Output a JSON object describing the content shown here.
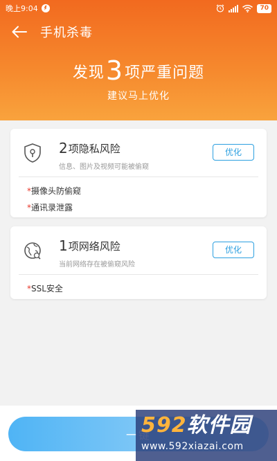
{
  "status_bar": {
    "time": "晚上9:04",
    "battery": "70"
  },
  "nav": {
    "title": "手机杀毒"
  },
  "summary": {
    "prefix": "发现",
    "count": "3",
    "suffix": "项严重问题",
    "subtitle": "建议马上优化"
  },
  "cards": [
    {
      "count": "2",
      "title": "项隐私风险",
      "description": "信息、图片及视频可能被偷窥",
      "button": "优化",
      "items": [
        "摄像头防偷窥",
        "通讯录泄露"
      ]
    },
    {
      "count": "1",
      "title": "项网络风险",
      "description": "当前网络存在被偷窥风险",
      "button": "优化",
      "items": [
        "SSL安全"
      ]
    }
  ],
  "risk_marker": "*",
  "bottom_button": "一键",
  "watermark": {
    "brand_a": "592",
    "brand_b": "软件园",
    "url": "www.592xiazai.com"
  },
  "colors": {
    "header_orange": "#f26a1f",
    "accent_blue": "#2b9fe0",
    "risk_red": "#e8382b"
  }
}
